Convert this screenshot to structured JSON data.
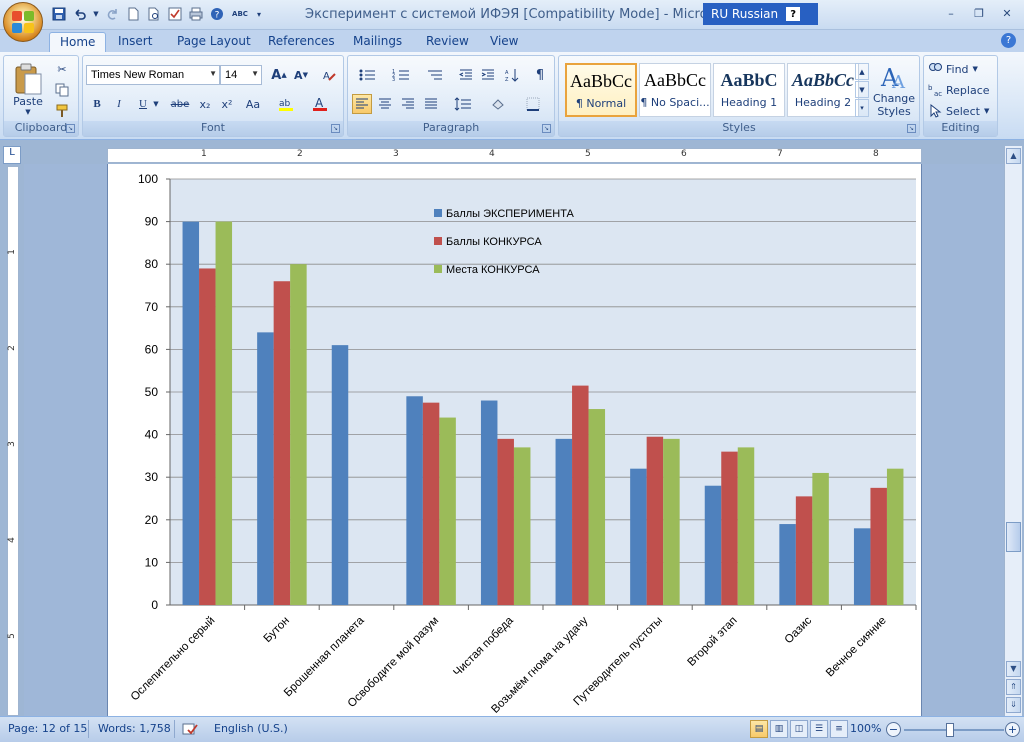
{
  "window": {
    "title": "Эксперимент с системой ИФЭЯ [Compatibility Mode] - Microsoft W",
    "language": "RU Russian",
    "help_symbol": "?",
    "controls": [
      "–",
      "❐",
      "✕"
    ]
  },
  "qat": {
    "icons": [
      "save-icon",
      "undo-icon",
      "redo-icon",
      "new-doc-icon",
      "print-preview-icon",
      "print-icon",
      "spelling-icon",
      "customize-icon"
    ]
  },
  "tabs": [
    "Home",
    "Insert",
    "Page Layout",
    "References",
    "Mailings",
    "Review",
    "View"
  ],
  "active_tab": "Home",
  "clipboard": {
    "paste_label": "Paste",
    "group_label": "Clipboard"
  },
  "font": {
    "family": "Times New Roman",
    "size": "14",
    "group_label": "Font",
    "bold": "B",
    "italic": "I",
    "underline": "U",
    "strike": "abe",
    "subscript": "x₂",
    "superscript": "x²",
    "change_case": "Aa"
  },
  "paragraph": {
    "group_label": "Paragraph"
  },
  "styles": {
    "group_label": "Styles",
    "items": [
      {
        "sample": "AaBbCc",
        "name": "¶ Normal"
      },
      {
        "sample": "AaBbCc",
        "name": "¶ No Spaci..."
      },
      {
        "sample": "AaBbC",
        "name": "Heading 1"
      },
      {
        "sample": "AaBbCc",
        "name": "Heading 2"
      }
    ],
    "change_styles": [
      "Change",
      "Styles"
    ]
  },
  "editing": {
    "group_label": "Editing",
    "find": "Find",
    "replace": "Replace",
    "select": "Select"
  },
  "ruler": {
    "h_numbers": [
      "1",
      "2",
      "3",
      "4",
      "5",
      "6",
      "7",
      "8"
    ],
    "v_numbers": [
      "1",
      "2",
      "3",
      "4",
      "5"
    ]
  },
  "chart_data": {
    "type": "bar",
    "categories": [
      "Ослепительно серый",
      "Бутон",
      "Брошенная планета",
      "Освободите мой разум",
      "Чистая победа",
      "Возьмём гнома на удачу",
      "Путеводитель пустоты",
      "Второй этап",
      "Оазис",
      "Вечное сияние"
    ],
    "series": [
      {
        "name": "Баллы ЭКСПЕРИМЕНТА",
        "color": "#4f81bd",
        "values": [
          90,
          64,
          61,
          49,
          48,
          39,
          32,
          28,
          19,
          18
        ]
      },
      {
        "name": "Баллы КОНКУРСА",
        "color": "#c0504d",
        "values": [
          79,
          76,
          null,
          47.5,
          39,
          51.5,
          39.5,
          36,
          25.5,
          27.5
        ]
      },
      {
        "name": "Места КОНКУРСА",
        "color": "#9bbb59",
        "values": [
          90,
          80,
          null,
          44,
          37,
          46,
          39,
          37,
          31,
          32
        ]
      }
    ],
    "ylim": [
      0,
      100
    ],
    "yticks": [
      0,
      10,
      20,
      30,
      40,
      50,
      60,
      70,
      80,
      90,
      100
    ],
    "grid": true,
    "legend_position": "top-center",
    "background": "#dce6f2",
    "xlabel": "",
    "ylabel": ""
  },
  "status": {
    "page": "Page: 12 of 15",
    "words": "Words: 1,758",
    "language": "English (U.S.)",
    "zoom": "100%"
  }
}
